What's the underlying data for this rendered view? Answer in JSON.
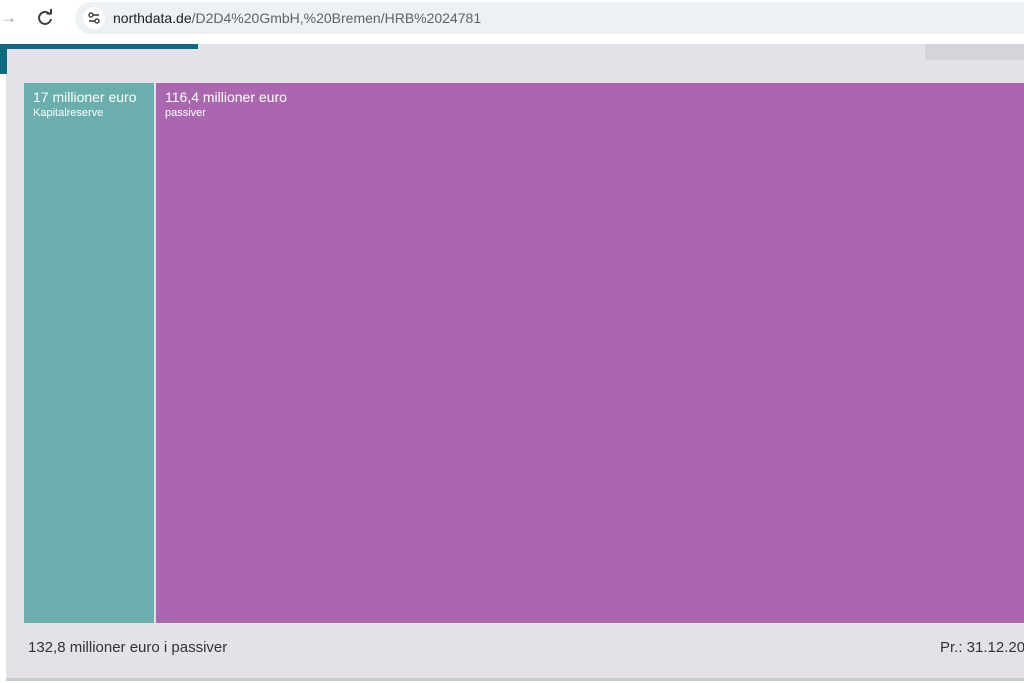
{
  "browser": {
    "url_domain": "northdata.de",
    "url_path": "/D2D4%20GmbH,%20Bremen/HRB%2024781",
    "forward_icon": "arrow-right-icon",
    "reload_icon": "reload-icon",
    "site_info_icon": "tune-icon"
  },
  "chart_data": {
    "type": "treemap",
    "title": "",
    "items": [
      {
        "value_text": "17 millioner euro",
        "label": "Kapitalreserve",
        "value": 17,
        "color": "#6aafad"
      },
      {
        "value_text": "116,4 millioner euro",
        "label": "passiver",
        "value": 116.4,
        "color": "#aa66ae"
      }
    ],
    "unit": "millioner euro",
    "total_text": "132,8 millioner euro i passiver",
    "date_text": "Pr.: 31.12.20"
  },
  "colors": {
    "accent": "#0c6a80",
    "panel": "#e4e2e8"
  }
}
